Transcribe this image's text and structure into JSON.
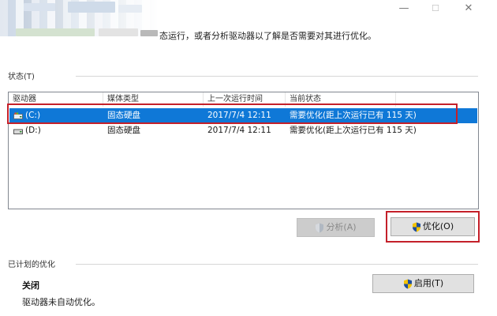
{
  "window": {
    "minimize_glyph": "—",
    "maximize_glyph": "☐",
    "close_glyph": "✕"
  },
  "intro_text": "态运行，或者分析驱动器以了解是否需要对其进行优化。",
  "status_section": {
    "label": "状态(T)"
  },
  "drive_list": {
    "columns": [
      "驱动器",
      "媒体类型",
      "上一次运行时间",
      "当前状态"
    ],
    "rows": [
      {
        "drive": "(C:)",
        "media": "固态硬盘",
        "last_run": "2017/7/4 12:11",
        "status": "需要优化(距上次运行已有 115 天)",
        "selected": true,
        "icon": "system-drive-icon"
      },
      {
        "drive": "(D:)",
        "media": "固态硬盘",
        "last_run": "2017/7/4 12:11",
        "status": "需要优化(距上次运行已有 115 天)",
        "selected": false,
        "icon": "drive-icon"
      }
    ]
  },
  "buttons": {
    "analyze": "分析(A)",
    "optimize": "优化(O)",
    "enable": "启用(T)"
  },
  "scheduled": {
    "label": "已计划的优化",
    "state": "关闭",
    "description": "驱动器未自动优化。"
  },
  "colors": {
    "selection": "#0f78d7",
    "highlight_box": "#c4202a"
  }
}
